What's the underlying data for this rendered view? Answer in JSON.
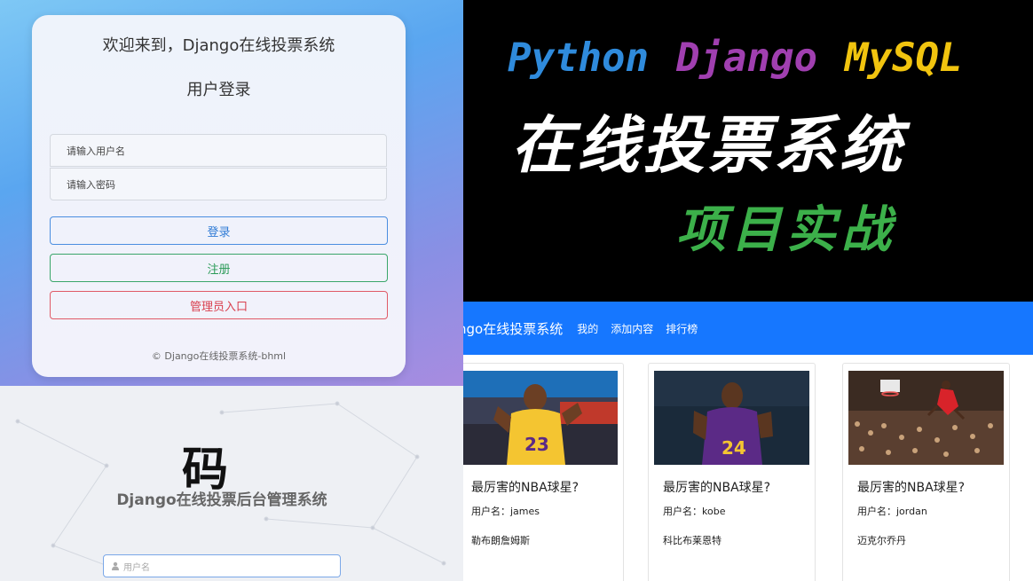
{
  "login": {
    "title": "欢迎来到，Django在线投票系统",
    "subtitle": "用户登录",
    "username_placeholder": "请输入用户名",
    "password_placeholder": "请输入密码",
    "login_button": "登录",
    "register_button": "注册",
    "admin_button": "管理员入口",
    "footer": "© Django在线投票系统-bhml"
  },
  "admin": {
    "logo_text": "码",
    "title": "Django在线投票后台管理系统",
    "username_placeholder": "用户名"
  },
  "banner": {
    "tech": [
      "Python",
      "Django",
      "MySQL"
    ],
    "title": "在线投票系统",
    "subtitle": "项目实战"
  },
  "nav": {
    "brand": "ngo在线投票系统",
    "links": [
      "我的",
      "添加内容",
      "排行榜"
    ]
  },
  "cards": [
    {
      "title": "最厉害的NBA球星?",
      "user": "用户名：james",
      "desc": "勒布朗詹姆斯",
      "image": "basketball-player-photo",
      "jersey": "23"
    },
    {
      "title": "最厉害的NBA球星?",
      "user": "用户名：kobe",
      "desc": "科比布莱恩特",
      "image": "basketball-player-photo",
      "jersey": "24"
    },
    {
      "title": "最厉害的NBA球星?",
      "user": "用户名：jordan",
      "desc": "迈克尔乔丹",
      "image": "basketball-dunk-photo"
    }
  ],
  "colors": {
    "nav_blue": "#1677ff",
    "login_blue": "#2f7bd6",
    "register_green": "#2a9a57",
    "admin_red": "#d9404f",
    "python_blue": "#2f8bdc",
    "django_purple": "#a03fb0",
    "mysql_yellow": "#f1c40f",
    "subtitle_green": "#3cb04a"
  }
}
